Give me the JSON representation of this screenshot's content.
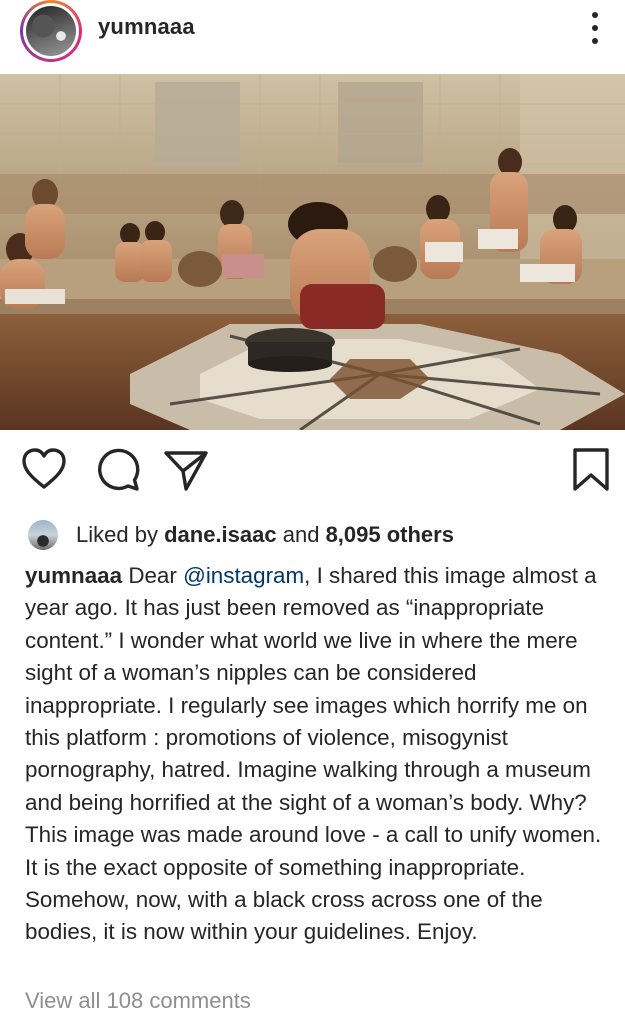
{
  "post": {
    "username": "yumnaaa",
    "more_icon": "more-vertical-icon"
  },
  "actions": {
    "like_icon": "heart-icon",
    "comment_icon": "comment-icon",
    "share_icon": "send-icon",
    "save_icon": "bookmark-icon"
  },
  "likes": {
    "prefix": "Liked by",
    "user": "dane.isaac",
    "and": "and",
    "others": "8,095 others"
  },
  "caption": {
    "username": "yumnaaa",
    "text_before": "Dear",
    "mention": "@instagram",
    "text_after": ", I shared this image almost a year ago. It has just been removed as “inappropriate content.” I wonder what world we live in where the mere sight of a woman’s nipples can be considered inappropriate. I regularly see images which horrify me on this platform : promotions of violence, misogynist pornography, hatred. Imagine walking through a museum and being horrified at the sight of a woman’s body. Why? This image was made around love - a call to unify women. It is the exact opposite of something inappropriate. Somehow, now, with a black cross across one of the bodies, it is now within your guidelines. Enjoy."
  },
  "comments": {
    "view_all": "View all 108 comments"
  },
  "colors": {
    "text": "#262626",
    "mention": "#00376b",
    "muted": "#8e8e8e"
  }
}
